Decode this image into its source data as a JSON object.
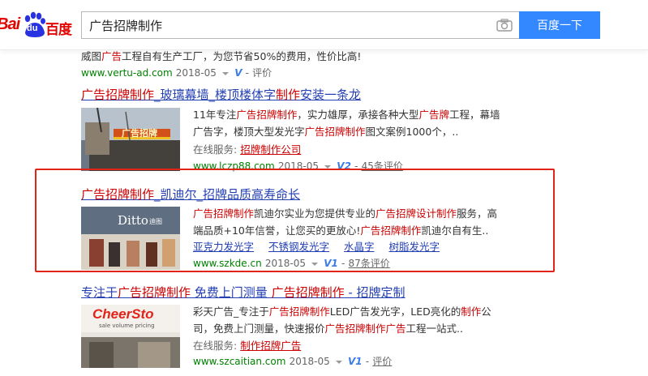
{
  "header": {
    "logo_latin": "Bai",
    "logo_du": "du",
    "logo_cn": "百度",
    "search_value": "广告招牌制作",
    "search_button": "百度一下"
  },
  "r0": {
    "desc": [
      "威图",
      "广告",
      "工程自有生产工厂，为您节省50%的费用，性价比高!"
    ],
    "url": "www.vertu-ad.com",
    "date": "2018-05",
    "v": "V",
    "eval": "评价"
  },
  "r1": {
    "title": [
      "广告招牌制作",
      "_玻璃幕墙_楼顶楼体字",
      "制作",
      "安装一条龙"
    ],
    "desc1": [
      "11年专注",
      "广告招牌制作",
      "，实力雄厚，承接各种大型",
      "广告牌",
      "工程，幕墙"
    ],
    "desc2": [
      "广告字，楼顶大型发光字",
      "广告招牌制作",
      "图文案例1000个，.."
    ],
    "service_label": "在线服务:",
    "service_link": "招牌制作公司",
    "url": "www.lczp88.com",
    "date": "2018-05",
    "v": "V",
    "v_level": "2",
    "eval": "45条评价",
    "thumb_text": "广告招牌"
  },
  "r2": {
    "title": [
      "广告招牌制作",
      "_凯迪尔_招牌品质高寿命长"
    ],
    "desc1": [
      "广告招牌制作",
      "凯迪尔实业为您提供专业的",
      "广告招牌设计制作",
      "服务，高"
    ],
    "desc2": [
      "端品质+10年信誉，让您买的更放心!",
      "广告招牌制作",
      "凯迪尔自有生.."
    ],
    "links": [
      "亚克力发光字",
      "不锈钢发光字",
      "水晶字",
      "树脂发光字"
    ],
    "url": "www.szkde.cn",
    "date": "2018-05",
    "v": "V",
    "v_level": "1",
    "eval": "87条评价",
    "thumb_brand": "Ditto",
    "thumb_sub": "迪图"
  },
  "r3": {
    "title": [
      "专注于",
      "广告招牌制作",
      " 免费上门测量 ",
      "广告招牌制作",
      " - 招牌定制"
    ],
    "desc1": [
      "彩天广告_专注于",
      "广告招牌制作",
      "LED广告发光字，LED亮化的",
      "制作",
      "公"
    ],
    "desc2": [
      "司，免费上门测量，快速报价",
      "广告招牌制作广告",
      "工程一站式.."
    ],
    "service_label": "在线服务:",
    "service_link": "制作招牌广告",
    "url": "www.szcaitian.com",
    "date": "2018-05",
    "v": "V",
    "v_level": "1",
    "eval": "评价",
    "thumb_brand": "CheerSto",
    "thumb_sub": "sale volume pricing"
  },
  "colors": {
    "accent": "#3388ff",
    "link": "#2440b3",
    "keyword": "#cc0000",
    "url": "#008000",
    "highlight": "#e2231a"
  }
}
